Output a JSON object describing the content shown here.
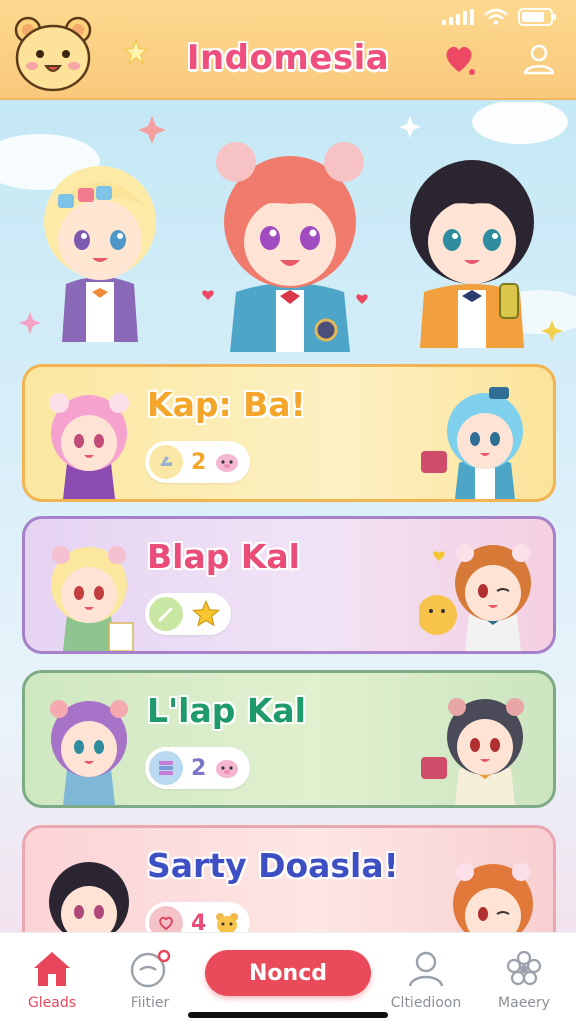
{
  "header": {
    "title": "Indomesia"
  },
  "icons": {
    "mascot": "bear-mascot-icon",
    "favorite": "heart-icon",
    "profile": "user-icon"
  },
  "cards": [
    {
      "title": "Kap: Ba!",
      "count": "2",
      "badge_icon": "hand-icon",
      "extra_icon": "pig-sticker-icon",
      "accent": "#f4a62a"
    },
    {
      "title": "Blap Kal",
      "count": "",
      "badge_icon": "pencil-icon",
      "extra_icon": "star-icon",
      "accent": "#ea4d78"
    },
    {
      "title": "L'lap Kal",
      "count": "2",
      "badge_icon": "stack-icon",
      "extra_icon": "pig-sticker-icon",
      "accent": "#1f9a6b"
    },
    {
      "title": "Sarty Doasla!",
      "count": "4",
      "badge_icon": "heart-badge-icon",
      "extra_icon": "bear-sticker-icon",
      "accent": "#3e4fc4"
    }
  ],
  "nav": {
    "items": [
      {
        "label": "Gleads",
        "icon": "home-icon",
        "active": true
      },
      {
        "label": "Fiitier",
        "icon": "chat-icon",
        "active": false
      },
      {
        "label": "Cltiedioon",
        "icon": "user-icon",
        "active": false
      },
      {
        "label": "Maeery",
        "icon": "flower-icon",
        "active": false
      }
    ],
    "cta_label": "Noncd"
  },
  "colors": {
    "header_bg": "#fcd98f",
    "title_pink": "#ef4f7d",
    "cta_red": "#ea4b5a"
  }
}
